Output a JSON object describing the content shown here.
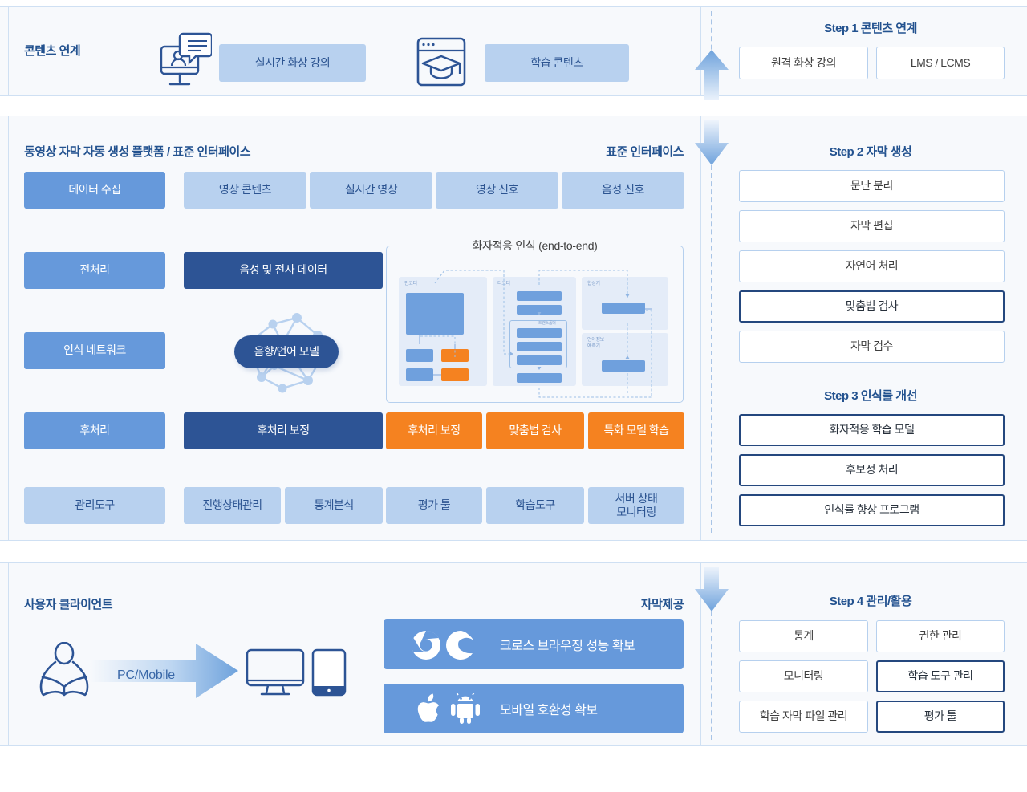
{
  "top_section": {
    "title": "콘텐츠 연계",
    "items": [
      {
        "icon": "video-lecture-monitor-icon",
        "label": "실시간 화상 강의"
      },
      {
        "icon": "learning-content-browser-icon",
        "label": "학습 콘텐츠"
      }
    ]
  },
  "middle_section": {
    "title_left": "동영상 자막 자동 생성 플랫폼  /  표준  인터페이스",
    "title_right": "표준  인터페이스",
    "row_collect": {
      "stage": "데이터 수집",
      "items": [
        "영상 콘텐츠",
        "실시간 영상",
        "영상 신호",
        "음성 신호"
      ]
    },
    "row_preprocess": {
      "stage": "전처리",
      "data_block": "음성 및 전사 데이터"
    },
    "row_network": {
      "stage": "인식 네트워크",
      "model_pill": "음향/언어 모델",
      "model_icon": "neural-network-brain-icon"
    },
    "e2e_diagram": {
      "title": "화자적응 인식 (end-to-end)",
      "columns": [
        {
          "label": "인코더"
        },
        {
          "label": "디코더",
          "sub_label": "트랜스폼더"
        },
        {
          "label": "합성기"
        },
        {
          "label": "언어정보\n예측기"
        }
      ]
    },
    "row_postprocess": {
      "stage": "후처리",
      "data_block": "후처리 보정",
      "items": [
        "후처리 보정",
        "맞춤법 검사",
        "특화 모델 학습"
      ]
    },
    "row_tools": {
      "stage": "관리도구",
      "items": [
        "진행상태관리",
        "통계분석",
        "평가 툴",
        "학습도구",
        "서버 상태\n모니터링"
      ]
    }
  },
  "bottom_section": {
    "title": "사용자 클라이언트",
    "arrow_label": "PC/Mobile",
    "reader_icon": "person-reading-book-icon",
    "devices": [
      "desktop-monitor-icon",
      "tablet-icon"
    ],
    "subtitle_right": "자막제공",
    "compat_items": [
      {
        "label": "크로스 브라우징 성능 확보",
        "icons": [
          "chrome-icon",
          "edge-icon"
        ]
      },
      {
        "label": "모바일 호환성 확보",
        "icons": [
          "apple-icon",
          "android-icon"
        ]
      }
    ]
  },
  "steps": {
    "step1": {
      "title": "Step 1 콘텐츠 연계",
      "items": [
        {
          "label": "원격 화상 강의",
          "emphasis": "light"
        },
        {
          "label": "LMS / LCMS",
          "emphasis": "light"
        }
      ]
    },
    "step2": {
      "title": "Step 2  자막 생성",
      "items": [
        {
          "label": "문단 분리",
          "emphasis": "light"
        },
        {
          "label": "자막 편집",
          "emphasis": "light"
        },
        {
          "label": "자연어 처리",
          "emphasis": "light"
        },
        {
          "label": "맞춤법 검사",
          "emphasis": "strong"
        },
        {
          "label": "자막 검수",
          "emphasis": "light"
        }
      ]
    },
    "step3": {
      "title": "Step 3 인식률 개선",
      "items": [
        {
          "label": "화자적응 학습 모델",
          "emphasis": "strong"
        },
        {
          "label": "후보정 처리",
          "emphasis": "strong"
        },
        {
          "label": "인식률 향상 프로그램",
          "emphasis": "strong"
        }
      ]
    },
    "step4": {
      "title": "Step 4 관리/활용",
      "items": [
        {
          "label": "통계",
          "emphasis": "light"
        },
        {
          "label": "권한 관리",
          "emphasis": "light"
        },
        {
          "label": "모니터링",
          "emphasis": "light"
        },
        {
          "label": "학습 도구 관리",
          "emphasis": "strong"
        },
        {
          "label": "학습 자막 파일 관리",
          "emphasis": "light"
        },
        {
          "label": "평가 툴",
          "emphasis": "strong"
        }
      ]
    }
  },
  "colors": {
    "navy": "#2d5495",
    "medium_blue": "#6699db",
    "light_blue": "#b8d1ef",
    "orange": "#f58220",
    "panel_bg": "#f7f9fc",
    "border": "#cfe0f3",
    "title_blue": "#23528f"
  }
}
